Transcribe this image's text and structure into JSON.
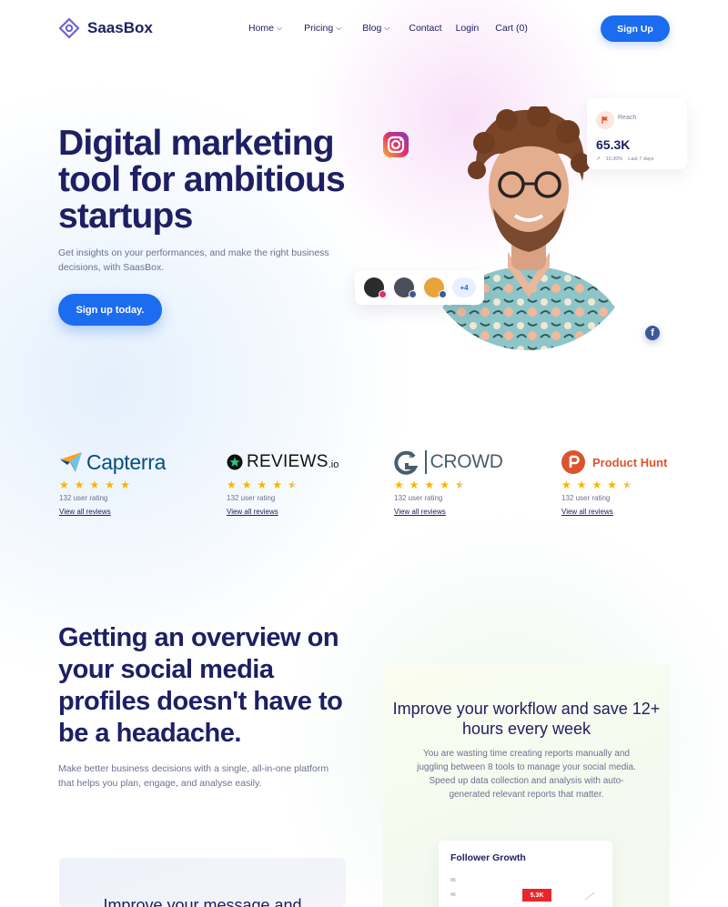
{
  "brand": {
    "name": "SaasBox",
    "accent": "#1c6cf0",
    "dark": "#1e2063"
  },
  "nav": {
    "items": [
      {
        "label": "Home",
        "has_dropdown": true
      },
      {
        "label": "Pricing",
        "has_dropdown": true
      },
      {
        "label": "Blog",
        "has_dropdown": true
      },
      {
        "label": "Contact",
        "has_dropdown": false
      },
      {
        "label": "Login",
        "has_dropdown": false
      },
      {
        "label": "Cart (0)",
        "has_dropdown": false
      }
    ],
    "signup_label": "Sign Up"
  },
  "hero": {
    "title": "Digital marketing tool for ambitious startups",
    "subtitle": "Get insights on your performances, and make the right business decisions, with SaasBox.",
    "cta_label": "Sign up today.",
    "reach": {
      "label": "Reach",
      "value": "65.3K",
      "change": "10.30%",
      "period": "Last 7 days"
    },
    "more_avatars": "+4"
  },
  "ratings": [
    {
      "brand": "Capterra",
      "stars": 5,
      "count": "132 user rating",
      "link": "View all reviews"
    },
    {
      "brand": "REVIEWS",
      "brand_suffix": ".io",
      "stars": 4.5,
      "count": "132 user rating",
      "link": "View all reviews"
    },
    {
      "brand": "CROWD",
      "brand_prefix": "G2",
      "stars": 4.5,
      "count": "132 user rating",
      "link": "View all reviews"
    },
    {
      "brand": "Product Hunt",
      "stars": 4.5,
      "count": "132 user rating",
      "link": "View all reviews"
    }
  ],
  "overview": {
    "title": "Getting an overview on your social media profiles doesn't have to be a headache.",
    "subtitle": "Make better business decisions with a single, all-in-one platform that helps you plan, engage, and analyse easily."
  },
  "workflow": {
    "title": "Improve your workflow and save 12+ hours every week",
    "subtitle": "You are wasting time creating reports manually and juggling between 8 tools to manage your social media. Speed up data collection and analysis with auto-generated relevant reports that matter.",
    "chart_title": "Follower Growth",
    "ticks": [
      "8K",
      "4K"
    ],
    "highlight_value": "5.3K"
  },
  "message_card": {
    "title": "Improve your message and"
  }
}
